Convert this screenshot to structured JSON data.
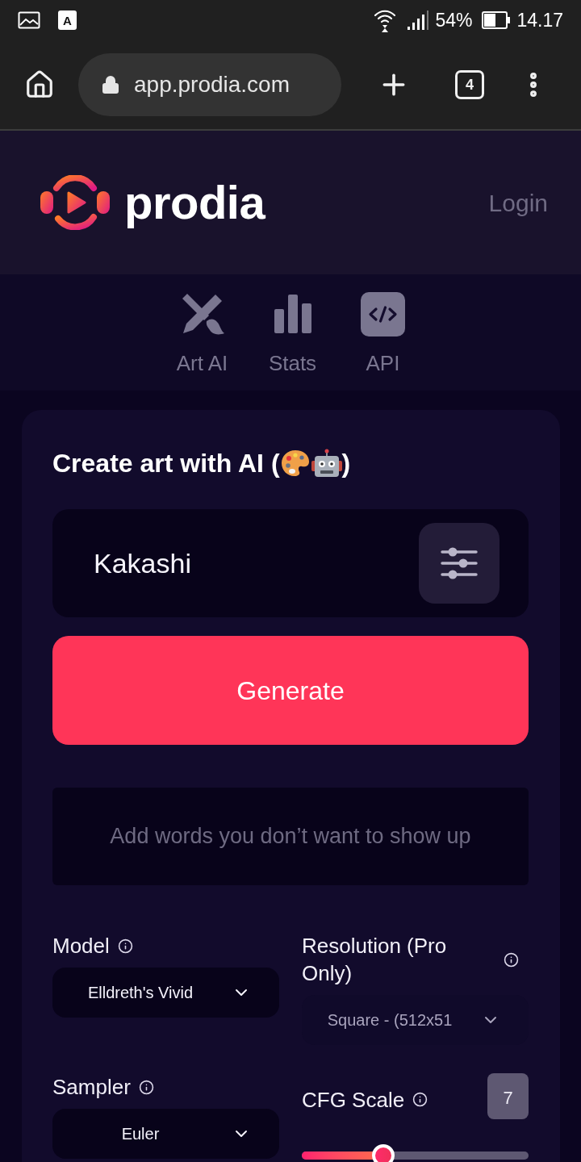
{
  "status_bar": {
    "app_icon_letter": "A",
    "battery": "54%",
    "time": "14.17"
  },
  "browser": {
    "url": "app.prodia.com",
    "tab_count": "4"
  },
  "header": {
    "logo_text": "prodia",
    "login": "Login"
  },
  "nav": [
    {
      "kind": "art",
      "label": "Art AI"
    },
    {
      "kind": "stats",
      "label": "Stats"
    },
    {
      "kind": "api",
      "label": "API"
    }
  ],
  "form": {
    "title_prefix": "Create art with AI (",
    "title_suffix": ")",
    "prompt": {
      "value": "Kakashi"
    },
    "generate": "Generate",
    "negative_prompt": {
      "placeholder": "Add words you don’t want to show up"
    },
    "settings": [
      {
        "kind": "select",
        "label": "Model",
        "value": "Elldreth's Vivid",
        "disabled": false
      },
      {
        "kind": "select",
        "label": "Resolution (Pro Only)",
        "value": "Square - (512x51",
        "disabled": true
      },
      {
        "kind": "select",
        "label": "Sampler",
        "value": "Euler",
        "disabled": false
      },
      {
        "kind": "slider",
        "label": "CFG Scale",
        "value": "7",
        "level": 0.36
      }
    ]
  }
}
